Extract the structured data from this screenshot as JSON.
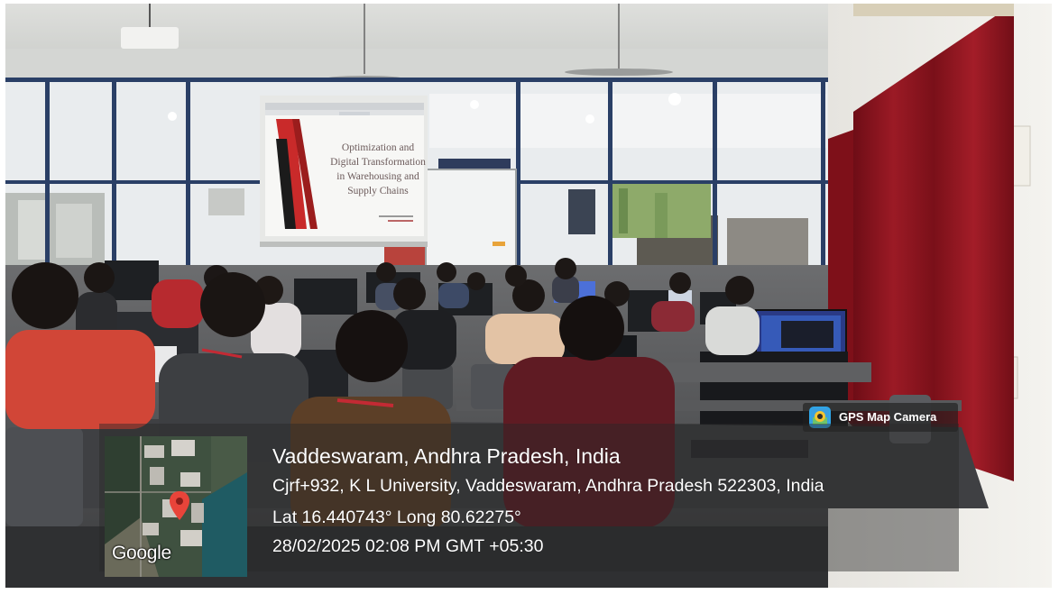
{
  "slide": {
    "title": "Optimization and Digital Transformation in Warehousing and Supply Chains"
  },
  "geotag": {
    "location_title": "Vaddeswaram, Andhra Pradesh, India",
    "address": "Cjrf+932, K L University, Vaddeswaram, Andhra Pradesh 522303, India",
    "coordinates": "Lat 16.440743° Long 80.62275°",
    "datetime": "28/02/2025 02:08 PM GMT +05:30"
  },
  "map": {
    "logo_text": "Google",
    "pin_icon": "map-pin-icon"
  },
  "app_badge": {
    "label": "GPS Map Camera",
    "icon": "gps-map-camera-icon"
  },
  "colors": {
    "curtain": "#8e1420",
    "pin": "#e8443a",
    "badge_icon": "#2fa6e8"
  }
}
